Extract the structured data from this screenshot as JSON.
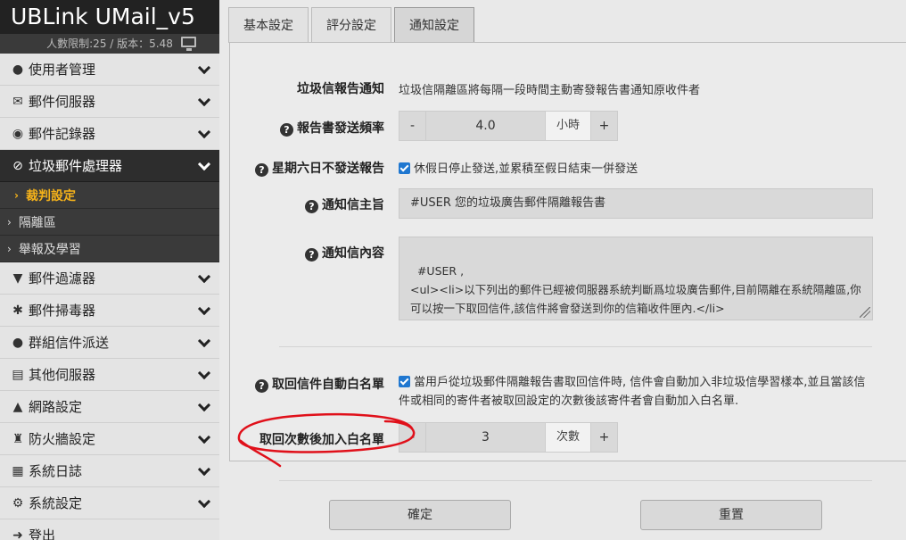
{
  "brand": {
    "title": "UBLink UMail_v5",
    "subtitle": "人數限制:25 / 版本：5.48",
    "monitor_icon": "monitor-icon"
  },
  "sidebar": {
    "items": [
      {
        "label": "使用者管理",
        "icon": "user-icon"
      },
      {
        "label": "郵件伺服器",
        "icon": "envelope-icon"
      },
      {
        "label": "郵件記錄器",
        "icon": "camera-icon"
      },
      {
        "label": "垃圾郵件處理器",
        "icon": "ban-icon"
      },
      {
        "label": "郵件過濾器",
        "icon": "filter-icon"
      },
      {
        "label": "郵件掃毒器",
        "icon": "bug-icon"
      },
      {
        "label": "群組信件派送",
        "icon": "users-icon"
      },
      {
        "label": "其他伺服器",
        "icon": "server-icon"
      },
      {
        "label": "網路設定",
        "icon": "sitemap-icon"
      },
      {
        "label": "防火牆設定",
        "icon": "fort-icon"
      },
      {
        "label": "系統日誌",
        "icon": "film-icon"
      },
      {
        "label": "系統設定",
        "icon": "gears-icon"
      },
      {
        "label": "登出",
        "icon": "logout-icon"
      }
    ],
    "subitems": [
      {
        "label": "裁判設定"
      },
      {
        "label": "隔離區"
      },
      {
        "label": "舉報及學習"
      }
    ]
  },
  "tabs": [
    {
      "label": "基本設定"
    },
    {
      "label": "評分設定"
    },
    {
      "label": "通知設定"
    }
  ],
  "form": {
    "report_label": "垃圾信報告通知",
    "report_text": "垃圾信隔離區將每隔一段時間主動寄發報告書通知原收件者",
    "freq_label": "報告書發送頻率",
    "freq_minus": "-",
    "freq_value": "4.0",
    "freq_unit": "小時",
    "freq_plus": "+",
    "weekend_label": "星期六日不發送報告",
    "weekend_text": "休假日停止發送,並累積至假日結束一併發送",
    "subject_label": "通知信主旨",
    "subject_value": "#USER 您的垃圾廣告郵件隔離報告書",
    "content_label": "通知信內容",
    "content_value": "#USER ,\n<ul><li>以下列出的郵件已經被伺服器系統判斷爲垃圾廣告郵件,目前隔離在系統隔離區,你可以按一下取回信件,該信件將會發送到你的信箱收件匣內.</li>\n<li>信件將被保存 #EXPIRE 天, 如有需取回信件請於期限內取回.</li></ul>",
    "whitelist_label": "取回信件自動白名單",
    "whitelist_text": "當用戶從垃圾郵件隔離報告書取回信件時, 信件會自動加入非垃圾信學習樣本,並且當該信件或相同的寄件者被取回設定的次數後該寄件者會自動加入白名單.",
    "count_label": "取回次數後加入白名單",
    "count_minus": "-",
    "count_value": "3",
    "count_unit": "次數",
    "count_plus": "+"
  },
  "actions": {
    "confirm": "確定",
    "reset": "重置"
  },
  "colors": {
    "accent": "#f5b21a",
    "checkbox": "#1f77d0",
    "annotation": "#e0101a"
  }
}
